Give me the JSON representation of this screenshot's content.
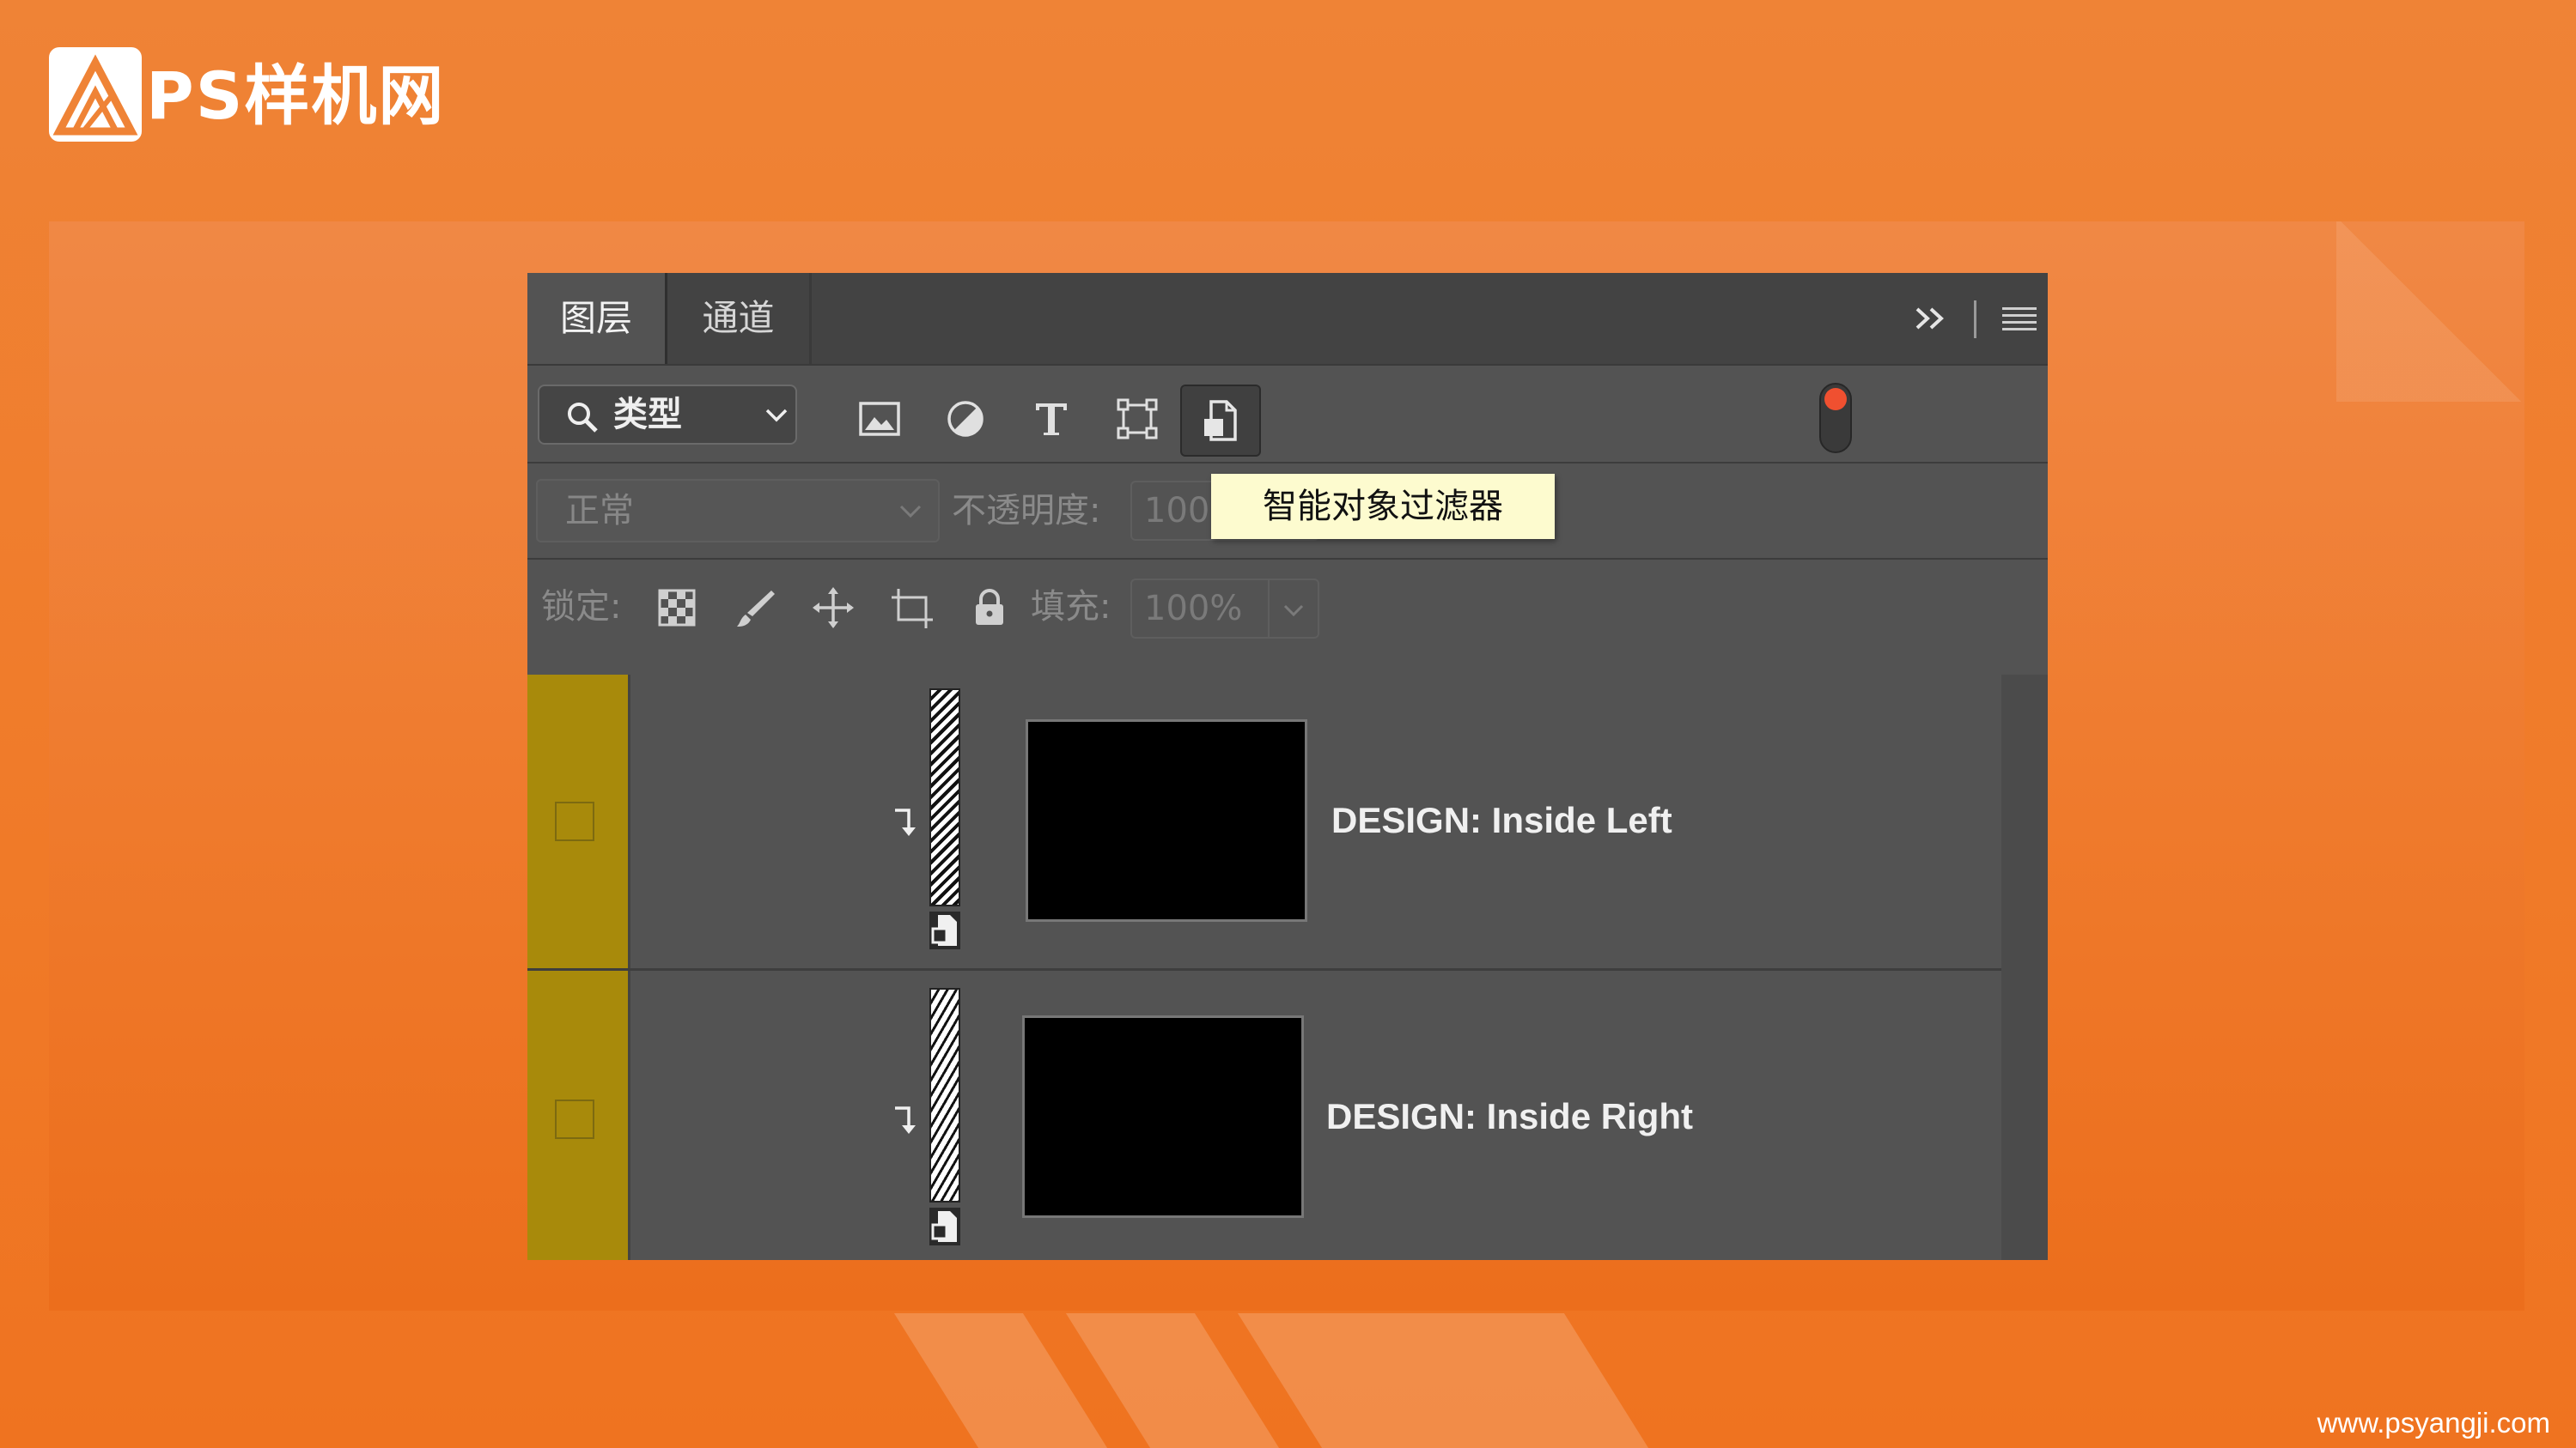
{
  "site": {
    "logo_text": "PS样机网",
    "footer_url": "www.psyangji.com"
  },
  "panel": {
    "tabs": [
      {
        "label": "图层",
        "active": true
      },
      {
        "label": "通道",
        "active": false
      }
    ],
    "filter": {
      "type_label": "类型",
      "filter_icons": [
        "image-filter-icon",
        "adjustment-filter-icon",
        "type-filter-icon",
        "shape-filter-icon",
        "smart-object-filter-icon"
      ],
      "active_filter": "smart-object-filter-icon",
      "toggle_color": "#f05030"
    },
    "blend": {
      "mode": "正常",
      "opacity_label": "不透明度:",
      "opacity_value": "100"
    },
    "lock": {
      "label": "锁定:",
      "icons": [
        "lock-transparent-icon",
        "lock-paint-icon",
        "lock-position-icon",
        "lock-artboard-icon",
        "lock-all-icon"
      ],
      "fill_label": "填充:",
      "fill_value": "100%"
    },
    "layers": [
      {
        "name": "DESIGN: Inside Left",
        "color_tag": "#a88a0b"
      },
      {
        "name": "DESIGN: Inside Right",
        "color_tag": "#a88a0b"
      }
    ],
    "tooltip": "智能对象过滤器"
  }
}
